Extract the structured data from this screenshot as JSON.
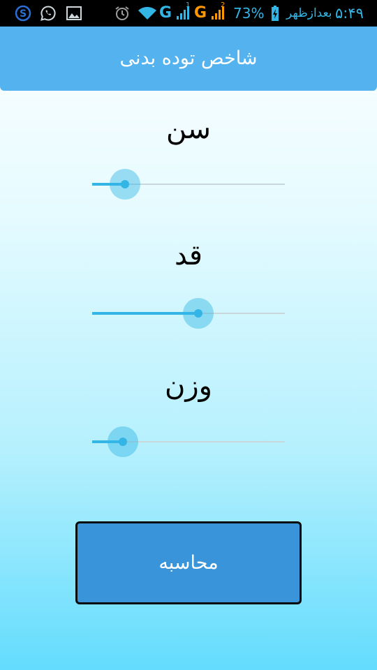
{
  "status_bar": {
    "time": "۵:۴۹",
    "period": "بعدازظهر",
    "battery": "73%",
    "network_1": "G",
    "network_2": "G",
    "sim_1": "1",
    "sim_2": "2",
    "icons": [
      "skype-icon",
      "whatsapp-icon",
      "gallery-icon",
      "alarm-icon",
      "wifi-icon",
      "signal-icon",
      "battery-charging-icon"
    ],
    "accent_color": "#33b5e5"
  },
  "app_bar": {
    "title": "شاخص توده بدنی",
    "background": "#54b3ef"
  },
  "fields": [
    {
      "label": "سن",
      "slider_value": 0.17
    },
    {
      "label": "قد",
      "slider_value": 0.55
    },
    {
      "label": "وزن",
      "slider_value": 0.16
    }
  ],
  "calculate_button": {
    "label": "محاسبه",
    "background": "#3a94d9"
  }
}
